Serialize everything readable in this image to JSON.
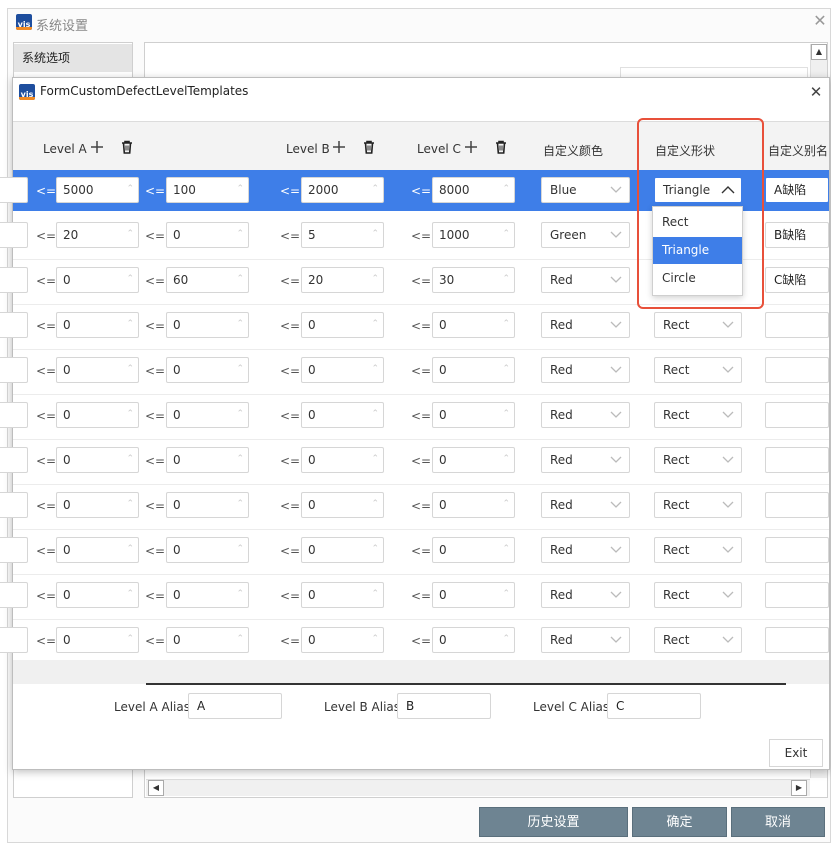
{
  "outer_window": {
    "title": "系统设置",
    "sidebar_item": "系统选项",
    "buttons": {
      "history": "历史设置",
      "confirm": "确定",
      "cancel": "取消"
    }
  },
  "dialog": {
    "title": "FormCustomDefectLevelTemplates",
    "app_icon_text": "vis",
    "headers": {
      "level_a": "Level A",
      "level_b": "Level B",
      "level_c": "Level C",
      "color": "自定义颜色",
      "shape": "自定义形状",
      "alias": "自定义别名"
    },
    "le_symbol": "<=",
    "rows": [
      {
        "a1": "5000",
        "a2": "100",
        "b": "2000",
        "c": "8000",
        "color": "Blue",
        "shape": "Triangle",
        "alias": "A缺陷"
      },
      {
        "a1": "20",
        "a2": "0",
        "b": "5",
        "c": "1000",
        "color": "Green",
        "shape": "",
        "alias": "B缺陷"
      },
      {
        "a1": "0",
        "a2": "60",
        "b": "20",
        "c": "30",
        "color": "Red",
        "shape": "",
        "alias": "C缺陷"
      },
      {
        "a1": "0",
        "a2": "0",
        "b": "0",
        "c": "0",
        "color": "Red",
        "shape": "Rect",
        "alias": ""
      },
      {
        "a1": "0",
        "a2": "0",
        "b": "0",
        "c": "0",
        "color": "Red",
        "shape": "Rect",
        "alias": ""
      },
      {
        "a1": "0",
        "a2": "0",
        "b": "0",
        "c": "0",
        "color": "Red",
        "shape": "Rect",
        "alias": ""
      },
      {
        "a1": "0",
        "a2": "0",
        "b": "0",
        "c": "0",
        "color": "Red",
        "shape": "Rect",
        "alias": ""
      },
      {
        "a1": "0",
        "a2": "0",
        "b": "0",
        "c": "0",
        "color": "Red",
        "shape": "Rect",
        "alias": ""
      },
      {
        "a1": "0",
        "a2": "0",
        "b": "0",
        "c": "0",
        "color": "Red",
        "shape": "Rect",
        "alias": ""
      },
      {
        "a1": "0",
        "a2": "0",
        "b": "0",
        "c": "0",
        "color": "Red",
        "shape": "Rect",
        "alias": ""
      },
      {
        "a1": "0",
        "a2": "0",
        "b": "0",
        "c": "0",
        "color": "Red",
        "shape": "Rect",
        "alias": ""
      }
    ],
    "shape_dropdown": {
      "options": [
        "Rect",
        "Triangle",
        "Circle"
      ],
      "highlighted": "Triangle"
    },
    "alias_fields": {
      "a_label": "Level A Alias:",
      "a_value": "A",
      "b_label": "Level B Alias:",
      "b_value": "B",
      "c_label": "Level C Alias:",
      "c_value": "C"
    },
    "exit_label": "Exit"
  },
  "colors": {
    "selection": "#3e7ee8",
    "footer_button": "#6e8492",
    "annotation": "#e8503a",
    "app_icon": "#1e4e9e",
    "app_icon_accent": "#f08a24"
  },
  "icons": [
    "plus-icon",
    "trash-icon",
    "chevron-down-icon",
    "chevron-up-icon",
    "close-icon",
    "vis-app-icon"
  ]
}
